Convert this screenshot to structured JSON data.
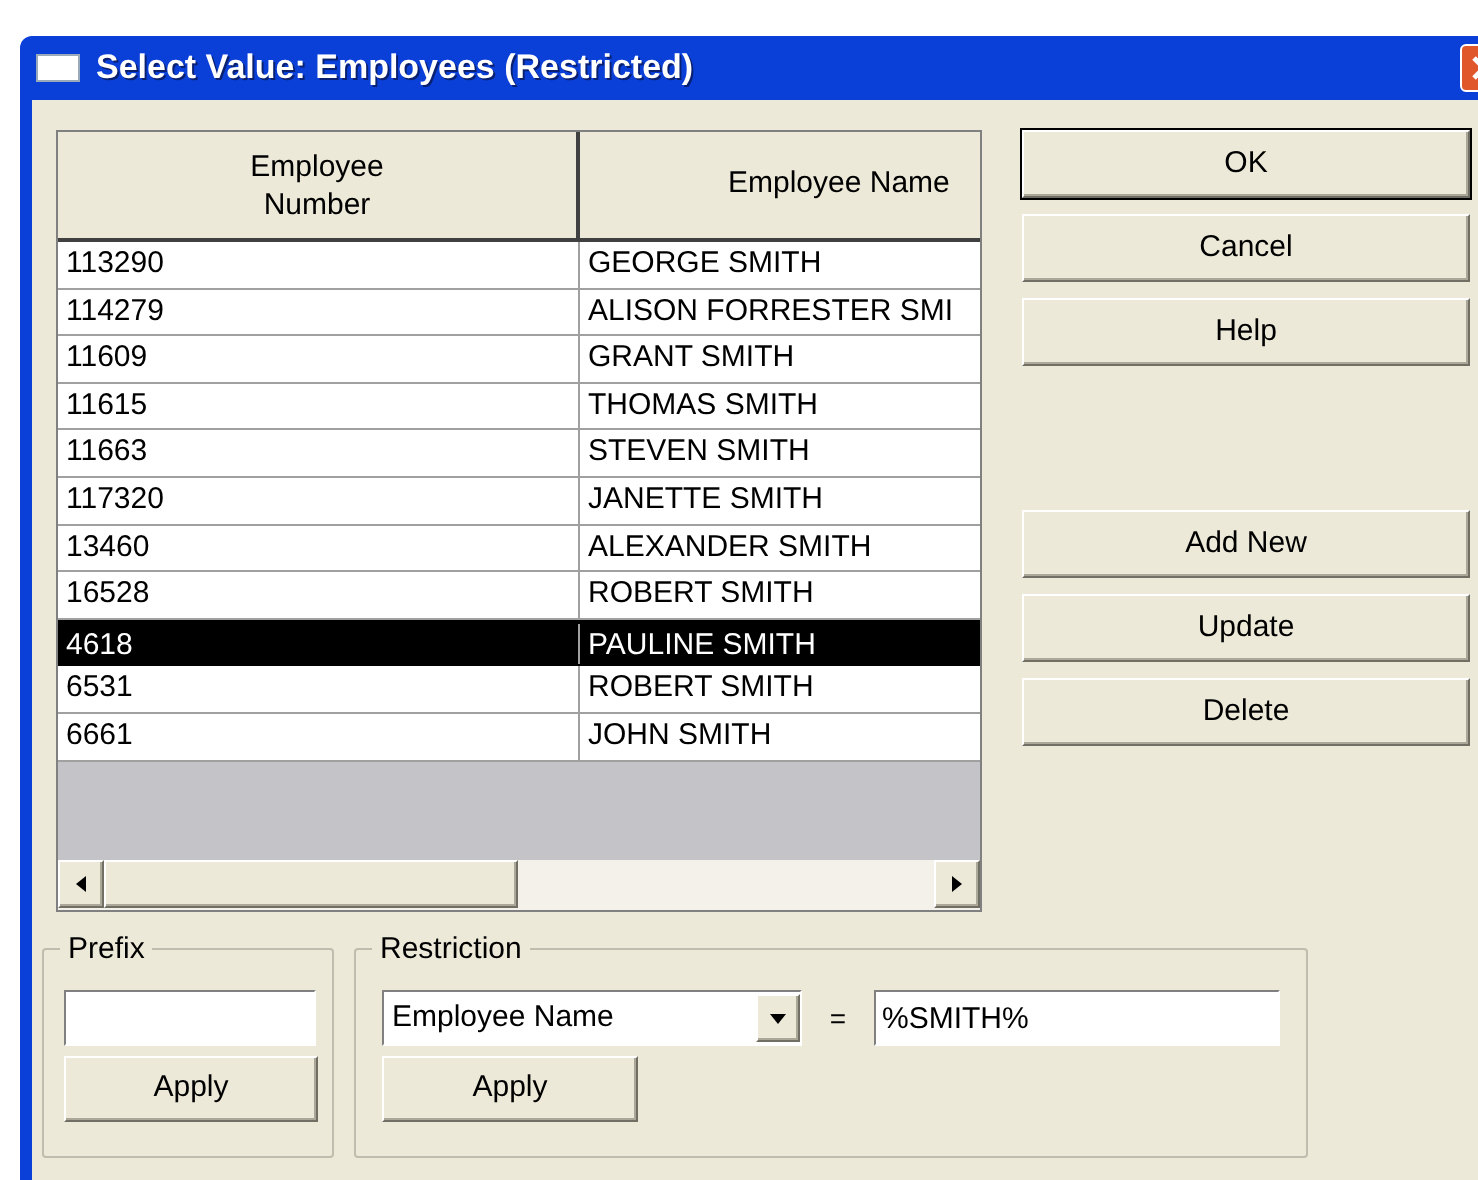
{
  "window": {
    "title": "Select Value: Employees (Restricted)"
  },
  "table": {
    "columns": [
      "Employee\nNumber",
      "Employee Name"
    ],
    "rows": [
      {
        "cells": [
          "113290",
          "GEORGE SMITH"
        ],
        "selected": false
      },
      {
        "cells": [
          "114279",
          "ALISON FORRESTER SMI"
        ],
        "selected": false
      },
      {
        "cells": [
          "11609",
          "GRANT SMITH"
        ],
        "selected": false
      },
      {
        "cells": [
          "11615",
          "THOMAS SMITH"
        ],
        "selected": false
      },
      {
        "cells": [
          "11663",
          "STEVEN SMITH"
        ],
        "selected": false
      },
      {
        "cells": [
          "117320",
          "JANETTE SMITH"
        ],
        "selected": false
      },
      {
        "cells": [
          "13460",
          "ALEXANDER SMITH"
        ],
        "selected": false
      },
      {
        "cells": [
          "16528",
          "ROBERT SMITH"
        ],
        "selected": false
      },
      {
        "cells": [
          "4618",
          "PAULINE SMITH"
        ],
        "selected": true
      },
      {
        "cells": [
          "6531",
          "ROBERT SMITH"
        ],
        "selected": false
      },
      {
        "cells": [
          "6661",
          "JOHN SMITH"
        ],
        "selected": false
      }
    ]
  },
  "button_groups": [
    [
      {
        "label": "OK",
        "default": true
      },
      {
        "label": "Cancel",
        "default": false
      },
      {
        "label": "Help",
        "default": false
      }
    ],
    [
      {
        "label": "Add New",
        "default": false
      },
      {
        "label": "Update",
        "default": false
      },
      {
        "label": "Delete",
        "default": false
      }
    ]
  ],
  "prefix": {
    "title": "Prefix",
    "button": "Apply"
  },
  "restriction": {
    "title": "Restriction",
    "field": "Employee Name",
    "operator": "=",
    "value": "%SMITH%",
    "button": "Apply"
  }
}
